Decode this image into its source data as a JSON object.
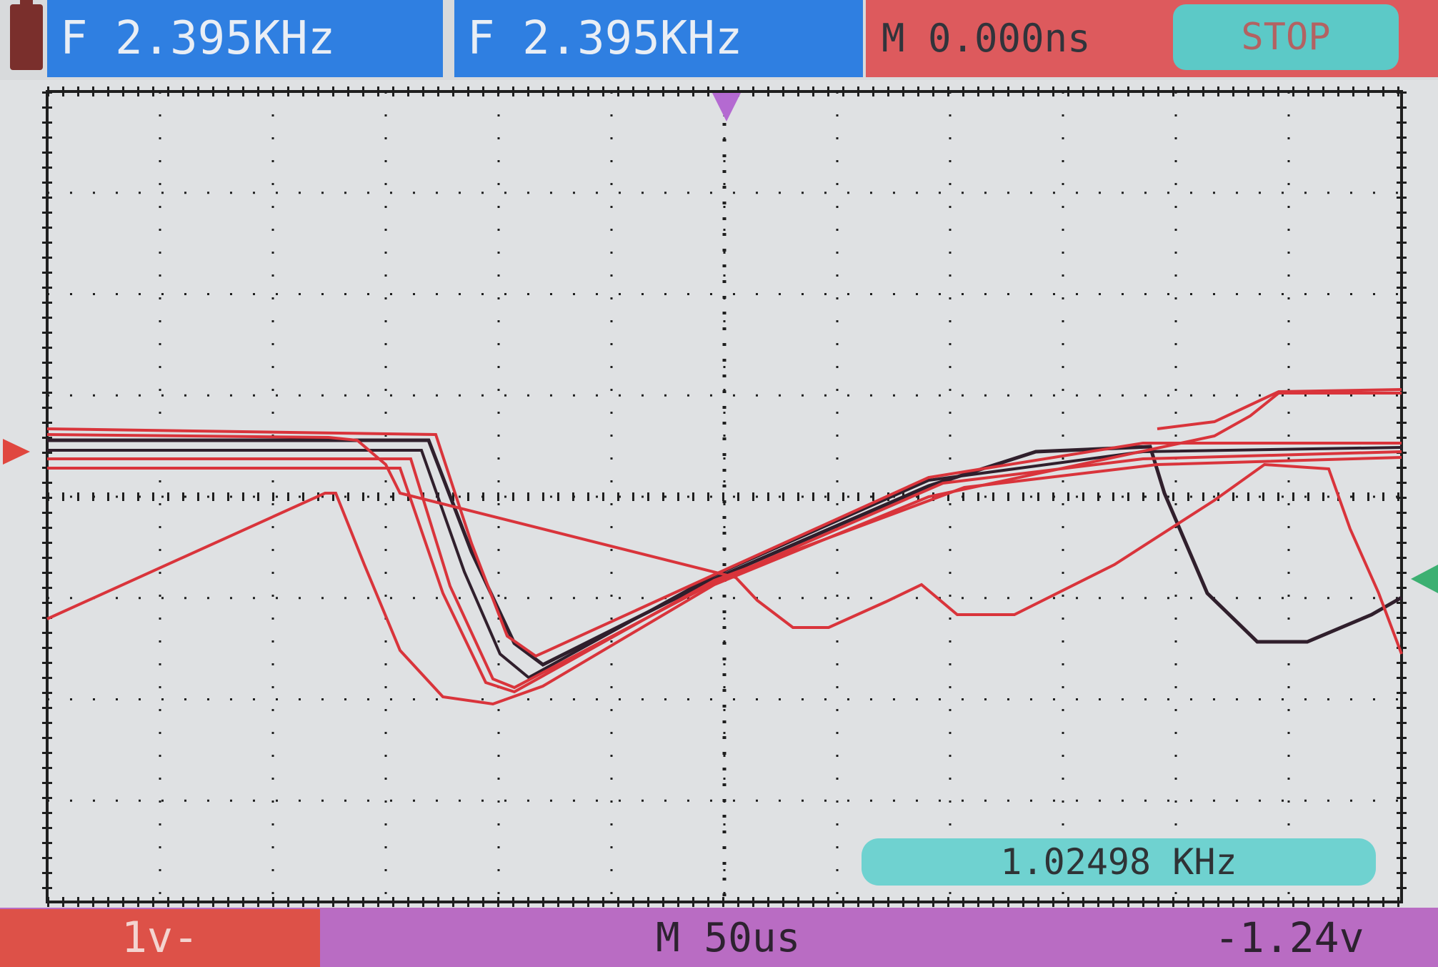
{
  "header": {
    "ch1_freq": "F 2.395KHz",
    "ch2_freq": "F 2.395KHz",
    "trigger_delay": "M 0.000ns",
    "run_state": "STOP"
  },
  "footer": {
    "volts_per_div": "1v-",
    "time_per_div": "M 50us",
    "trigger_level": "-1.24v"
  },
  "measurement": {
    "frequency": "1.02498 KHz"
  },
  "colors": {
    "background": "#dfe1e3",
    "grid": "#1f1f1f",
    "channel_panel": "#2f7fe1",
    "trigger_panel": "#dd5a5d",
    "stop_badge": "#5cc9c7",
    "volts_panel": "#dd5148",
    "footer_bar": "#b96cc3",
    "measure_badge": "#6fd2d0",
    "trace_red": "#d9343b",
    "trace_dark": "#301f2c",
    "ref_marker": "#e0473f",
    "trigger_marker": "#b46ad1",
    "ch2_marker": "#3cb072"
  },
  "icons": [
    "battery-icon",
    "ground-reference-marker",
    "trigger-position-marker",
    "channel2-level-marker"
  ]
}
